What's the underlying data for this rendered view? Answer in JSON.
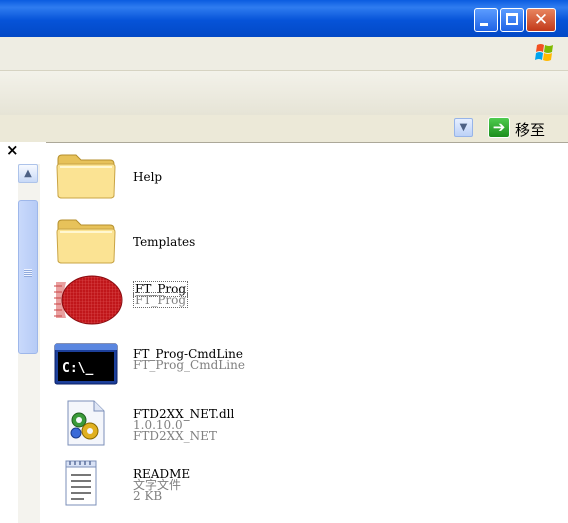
{
  "window": {
    "minimize_icon": "minimize-icon",
    "maximize_icon": "maximize-icon",
    "close_icon": "close-icon"
  },
  "menubar": {
    "logo_icon": "windows-logo-icon"
  },
  "addressbar": {
    "dropdown_icon": "chevron-down-icon",
    "go_label": "移至",
    "go_icon": "go-arrow-icon"
  },
  "leftpane": {
    "close_label": "×",
    "scroll_up_icon": "chevron-up-icon"
  },
  "files": [
    {
      "name": "Help",
      "lines": [],
      "icon": "folder-icon"
    },
    {
      "name": "Templates",
      "lines": [],
      "icon": "folder-icon"
    },
    {
      "name": "FT_Prog",
      "lines": [
        "FT_Prog"
      ],
      "icon": "ft-prog-app-icon",
      "focused": true
    },
    {
      "name": "FT_Prog-CmdLine",
      "lines": [
        "FT_Prog_CmdLine"
      ],
      "icon": "command-prompt-icon"
    },
    {
      "name": "FTD2XX_NET.dll",
      "lines": [
        "1.0.10.0",
        "FTD2XX_NET"
      ],
      "icon": "dll-file-icon"
    },
    {
      "name": "README",
      "lines": [
        "文字文件",
        "2 KB"
      ],
      "icon": "text-document-icon"
    }
  ],
  "colors": {
    "titlebar": "#0653d8",
    "menubar": "#eeede3",
    "subtext": "#808080"
  }
}
